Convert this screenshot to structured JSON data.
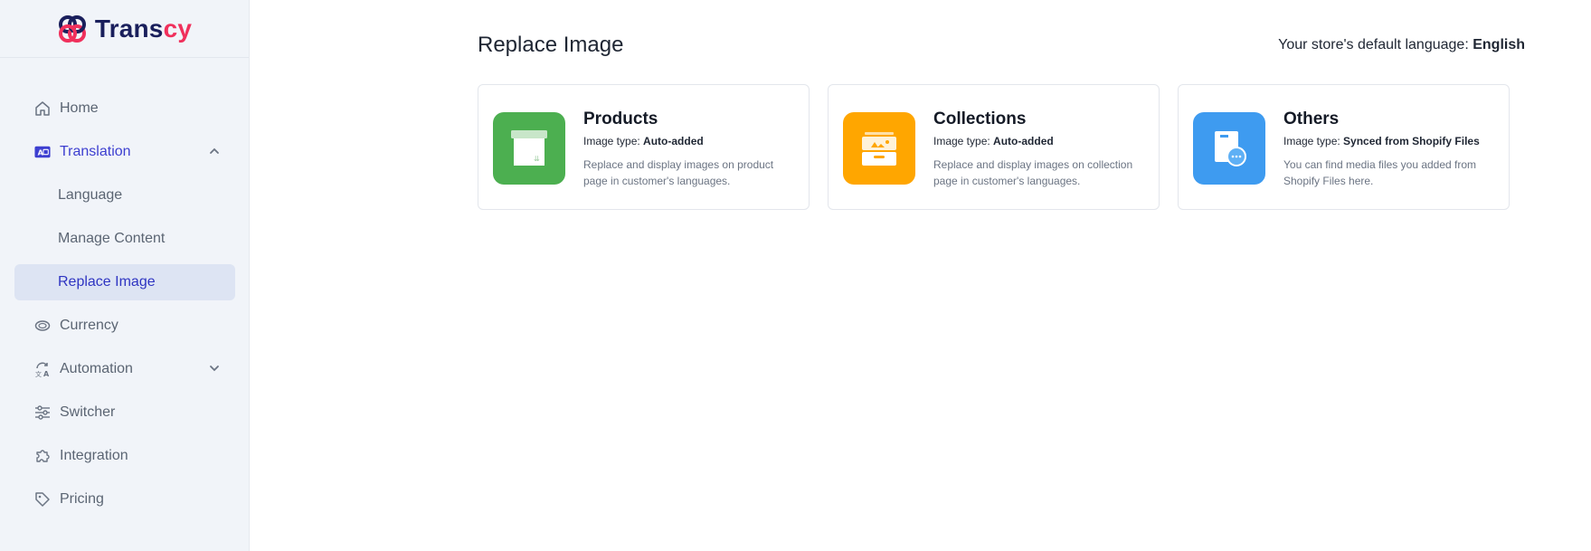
{
  "brand": {
    "part1": "Trans",
    "part2": "cy"
  },
  "sidebar": {
    "items": [
      {
        "label": "Home"
      },
      {
        "label": "Translation"
      },
      {
        "label": "Language"
      },
      {
        "label": "Manage Content"
      },
      {
        "label": "Replace Image"
      },
      {
        "label": "Currency"
      },
      {
        "label": "Automation"
      },
      {
        "label": "Switcher"
      },
      {
        "label": "Integration"
      },
      {
        "label": "Pricing"
      }
    ]
  },
  "header": {
    "title": "Replace Image",
    "default_lang_prefix": "Your store's default language:",
    "default_lang_value": "English"
  },
  "cards": [
    {
      "title": "Products",
      "type_prefix": "Image type:",
      "type_value": "Auto-added",
      "desc": "Replace and display images on product page in customer's languages.",
      "color": "#4caf50"
    },
    {
      "title": "Collections",
      "type_prefix": "Image type:",
      "type_value": "Auto-added",
      "desc": "Replace and display images on collection page in customer's languages.",
      "color": "#ffa600"
    },
    {
      "title": "Others",
      "type_prefix": "Image type:",
      "type_value": "Synced from Shopify Files",
      "desc": "You can find media files you added from Shopify Files here.",
      "color": "#3e9bf0"
    }
  ],
  "colors": {
    "accent": "#3d3fd0",
    "active_bg": "#dde4f3",
    "brand_navy": "#1a1f5c",
    "brand_pink": "#f0305c"
  }
}
